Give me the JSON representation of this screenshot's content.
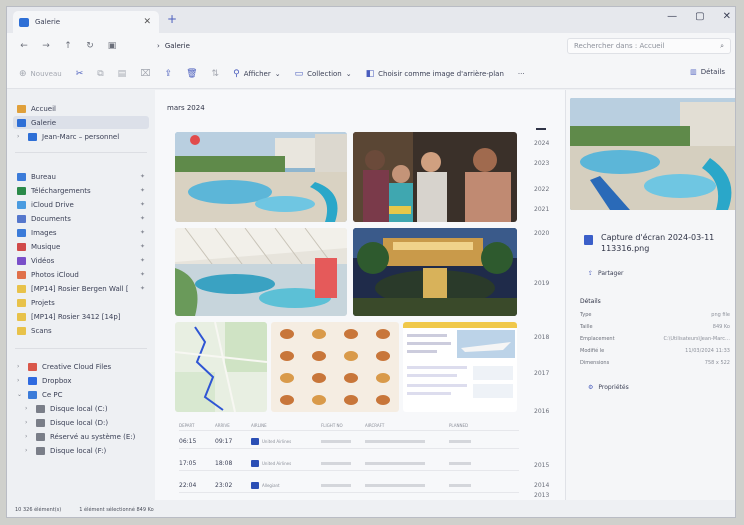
{
  "window": {
    "tab_title": "Galerie",
    "search_placeholder": "Rechercher dans : Accueil",
    "breadcrumb": [
      "Galerie"
    ]
  },
  "commands": {
    "new": "Nouveau",
    "filter": "Afficher",
    "collection": "Collection",
    "background": "Choisir comme image d'arrière-plan",
    "more": "···",
    "details": "Détails"
  },
  "sidebar": {
    "items": [
      {
        "label": "Accueil",
        "icon": "home-icon",
        "color": "#e0a03a"
      },
      {
        "label": "Galerie",
        "icon": "gallery-icon",
        "color": "#2e6fd6"
      },
      {
        "label": "Jean-Marc – personnel",
        "icon": "cloud-icon",
        "color": "#2e6fd6"
      },
      {
        "label": "Bureau",
        "icon": "desktop-icon",
        "color": "#3b7bd9"
      },
      {
        "label": "Téléchargements",
        "icon": "download-icon",
        "color": "#2b8a4a"
      },
      {
        "label": "iCloud Drive",
        "icon": "icloud-icon",
        "color": "#4a9be0"
      },
      {
        "label": "Documents",
        "icon": "documents-icon",
        "color": "#5577cc"
      },
      {
        "label": "Images",
        "icon": "images-icon",
        "color": "#3b7bd9"
      },
      {
        "label": "Musique",
        "icon": "music-icon",
        "color": "#d04a4a"
      },
      {
        "label": "Vidéos",
        "icon": "videos-icon",
        "color": "#7a4fc9"
      },
      {
        "label": "Photos iCloud",
        "icon": "photos-icon",
        "color": "#e0704a"
      },
      {
        "label": "[MP14] Rosier Bergen Wall [",
        "icon": "folder-icon",
        "color": "#e8c24a"
      },
      {
        "label": "Projets",
        "icon": "folder-icon",
        "color": "#e8c24a"
      },
      {
        "label": "[MP14] Rosier 3412 [14p]",
        "icon": "folder-icon",
        "color": "#e8c24a"
      },
      {
        "label": "Scans",
        "icon": "folder-icon",
        "color": "#e8c24a"
      },
      {
        "label": "Creative Cloud Files",
        "icon": "cc-icon",
        "color": "#d9574a"
      },
      {
        "label": "Dropbox",
        "icon": "dropbox-icon",
        "color": "#2f6ae0"
      },
      {
        "label": "Ce PC",
        "icon": "pc-icon",
        "color": "#3b7bd9"
      },
      {
        "label": "Disque local (C:)",
        "icon": "drive-icon",
        "color": "#7a7e88"
      },
      {
        "label": "Disque local (D:)",
        "icon": "drive-icon",
        "color": "#7a7e88"
      },
      {
        "label": "Réservé au système (E:)",
        "icon": "drive-icon",
        "color": "#7a7e88"
      },
      {
        "label": "Disque local (F:)",
        "icon": "drive-icon",
        "color": "#7a7e88"
      }
    ]
  },
  "gallery": {
    "month_label": "mars 2024",
    "years": [
      "2024",
      "2023",
      "2022",
      "2021",
      "2020",
      "2019",
      "2018",
      "2017",
      "2016",
      "2015",
      "2014",
      "2013"
    ],
    "flights": {
      "headers": [
        "DEPART",
        "ARRIVE",
        "AIRLINE",
        "FLIGHT NO",
        "AIRCRAFT",
        "PLANNED"
      ],
      "rows": [
        {
          "depart": "06:15",
          "arrive": "09:17",
          "airline": "United Airlines"
        },
        {
          "depart": "17:05",
          "arrive": "18:08",
          "airline": "United Airlines"
        },
        {
          "depart": "22:04",
          "arrive": "23:02",
          "airline": "Allegiant"
        }
      ]
    }
  },
  "details_pane": {
    "file_name": "Capture d'écran 2024-03-11 113316.png",
    "location": "Partager",
    "section": "Détails",
    "props": [
      {
        "k": "Type",
        "v": "png file"
      },
      {
        "k": "Taille",
        "v": "849 Ko"
      },
      {
        "k": "Emplacement",
        "v": "C:\\Utilisateurs\\Jean-Marc…"
      },
      {
        "k": "Modifié le",
        "v": "11/03/2024 11:33"
      },
      {
        "k": "Dimensions",
        "v": "758 x 522"
      }
    ],
    "properties_btn": "Propriétés"
  },
  "status": {
    "count": "10 326 élément(s)",
    "selected": "1 élément sélectionné  849 Ko"
  }
}
